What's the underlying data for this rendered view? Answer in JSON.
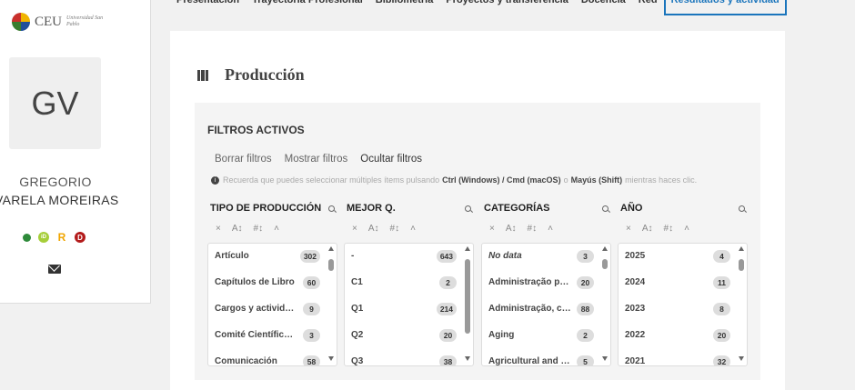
{
  "logo": {
    "text": "CEU",
    "sub": "Universidad San Pablo"
  },
  "profile": {
    "initials": "GV",
    "first_name": "GREGORIO",
    "last_name": "VARELA MOREIRAS"
  },
  "topnav": [
    "Presentación",
    "Trayectoria Profesional",
    "Bibliometría",
    "Proyectos y transferencia",
    "Docencia",
    "Red",
    "Resultados y actividad"
  ],
  "section": {
    "title": "Producción"
  },
  "filters": {
    "title": "FILTROS ACTIVOS",
    "actions": [
      "Borrar filtros",
      "Mostrar filtros",
      "Ocultar filtros"
    ],
    "tip": {
      "before": "Recuerda que puedes seleccionar múltiples ítems pulsando",
      "keys1": "Ctrl (Windows) / Cmd (macOS)",
      "or": "o",
      "keys2": "Mayús (Shift)",
      "after": "mientras haces clic."
    }
  },
  "facets": [
    {
      "title": "TIPO DE PRODUCCIÓN",
      "thumb_top": 0.05,
      "thumb_size": 0.12,
      "items": [
        {
          "label": "Artículo",
          "count": "302"
        },
        {
          "label": "Capítulos de Libro",
          "count": "60"
        },
        {
          "label": "Cargos y actividades...",
          "count": "9"
        },
        {
          "label": "Comité Científico en...",
          "count": "3"
        },
        {
          "label": "Comunicación",
          "count": "58"
        }
      ]
    },
    {
      "title": "MEJOR Q.",
      "thumb_top": 0.05,
      "thumb_size": 0.75,
      "items": [
        {
          "label": "-",
          "count": "643"
        },
        {
          "label": "C1",
          "count": "2"
        },
        {
          "label": "Q1",
          "count": "214"
        },
        {
          "label": "Q2",
          "count": "20"
        },
        {
          "label": "Q3",
          "count": "38"
        }
      ]
    },
    {
      "title": "CATEGORÍAS",
      "thumb_top": 0.05,
      "thumb_size": 0.1,
      "first_italic": true,
      "items": [
        {
          "label": "No data",
          "count": "3"
        },
        {
          "label": "Administração públi...",
          "count": "20"
        },
        {
          "label": "Administração, ciên...",
          "count": "88"
        },
        {
          "label": "Aging",
          "count": "2"
        },
        {
          "label": "Agricultural and biol...",
          "count": "5"
        }
      ]
    },
    {
      "title": "AÑO",
      "thumb_top": 0.05,
      "thumb_size": 0.12,
      "items": [
        {
          "label": "2025",
          "count": "4"
        },
        {
          "label": "2024",
          "count": "11"
        },
        {
          "label": "2023",
          "count": "8"
        },
        {
          "label": "2022",
          "count": "20"
        },
        {
          "label": "2021",
          "count": "32"
        }
      ]
    }
  ],
  "facet_tools": [
    "×",
    "A↕",
    "#↕",
    "˄"
  ]
}
